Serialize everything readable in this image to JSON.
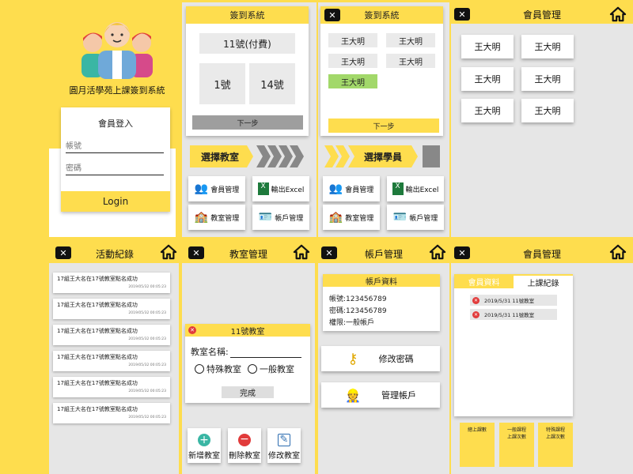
{
  "app": {
    "name": "圓月活學苑上課簽到系統"
  },
  "login": {
    "title": "會員登入",
    "account_placeholder": "帳號",
    "password_placeholder": "密碼",
    "button": "Login"
  },
  "checkin1": {
    "title": "簽到系統",
    "paid_label": "11號(付費)",
    "seats": [
      "1號",
      "14號"
    ],
    "next": "下一步"
  },
  "checkin2": {
    "title": "簽到系統",
    "names": [
      "王大明",
      "王大明",
      "王大明",
      "王大明",
      "王大明"
    ],
    "next": "下一步"
  },
  "members_top": {
    "title": "會員管理",
    "names": [
      "王大明",
      "王大明",
      "王大明",
      "王大明",
      "王大明",
      "王大明"
    ]
  },
  "steps": {
    "step1": "選擇教室",
    "step2": "選擇學員"
  },
  "menu": {
    "member": "會員管理",
    "excel": "輸出Excel",
    "classroom": "教室管理",
    "account": "帳戶管理"
  },
  "activity": {
    "title": "活動紀錄",
    "records": [
      {
        "text": "17組王大名在17號教室點名成功",
        "date": "2019/05/32 00:05:23"
      },
      {
        "text": "17組王大名在17號教室點名成功",
        "date": "2019/05/32 00:05:23"
      },
      {
        "text": "17組王大名在17號教室點名成功",
        "date": "2019/05/32 00:05:23"
      },
      {
        "text": "17組王大名在17號教室點名成功",
        "date": "2019/05/32 00:05:23"
      },
      {
        "text": "17組王大名在17號教室點名成功",
        "date": "2019/05/32 00:05:23"
      },
      {
        "text": "17組王大名在17號教室點名成功",
        "date": "2019/05/32 00:05:23"
      }
    ]
  },
  "classroom": {
    "title": "教室管理",
    "dialog_title": "11號教室",
    "name_label": "教室名稱:",
    "option_special": "特殊教室",
    "option_normal": "一般教室",
    "done": "完成",
    "add": "新增教室",
    "delete": "刪除教室",
    "edit": "修改教室"
  },
  "account": {
    "title": "帳戶管理",
    "info_title": "帳戶資料",
    "account_line": "帳號:123456789",
    "password_line": "密碼:123456789",
    "permission_line": "權限:一般帳戶",
    "change_password": "修改密碼",
    "manage_account": "管理帳戶"
  },
  "member_detail": {
    "title": "會員管理",
    "tab_info": "會員資料",
    "tab_records": "上課紀錄",
    "records": [
      "2019/5/31 11號教室",
      "2019/5/31 11號教室"
    ],
    "stats": [
      "總上課數",
      "一般課程\n上課次數",
      "特殊課程\n上課次數"
    ]
  },
  "colors": {
    "yellow": "#fedd4e",
    "gray": "#e6e6e6",
    "green": "#a2d86a",
    "red": "#e13b3b"
  }
}
